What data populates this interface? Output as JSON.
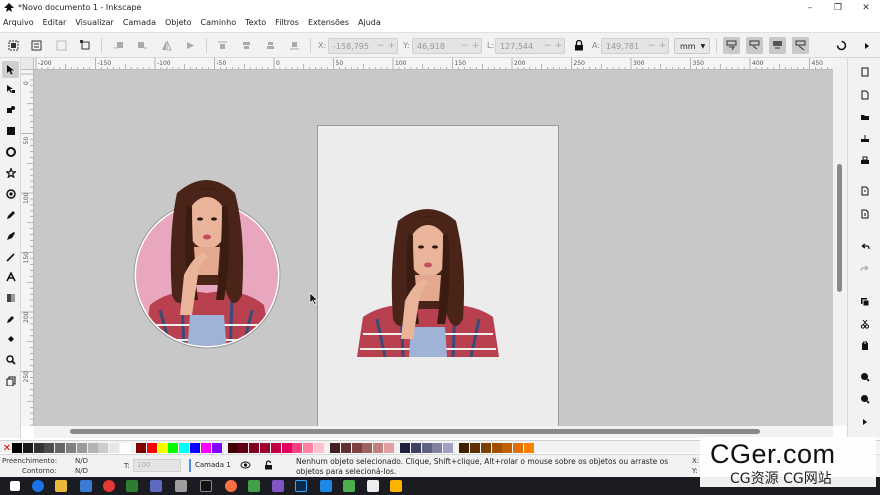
{
  "window": {
    "title": "*Novo documento 1 - Inkscape",
    "controls": [
      "minimize",
      "maximize",
      "close"
    ],
    "minimize_glyph": "–",
    "maximize_glyph": "❐",
    "close_glyph": "✕"
  },
  "menubar": {
    "items": [
      "Arquivo",
      "Editar",
      "Visualizar",
      "Camada",
      "Objeto",
      "Caminho",
      "Texto",
      "Filtros",
      "Extensões",
      "Ajuda"
    ]
  },
  "controls": {
    "x": {
      "label": "X:",
      "value": "-158,795"
    },
    "y": {
      "label": "Y:",
      "value": "46,918"
    },
    "w": {
      "label": "L:",
      "value": "127,544"
    },
    "h": {
      "label": "A:",
      "value": "149,781"
    },
    "unit": "mm",
    "spin_minus": "−",
    "spin_plus": "+"
  },
  "rulers": {
    "top_labels": [
      "-200",
      "-150",
      "-100",
      "-50",
      "0",
      "50",
      "100",
      "150",
      "200",
      "250",
      "300",
      "350",
      "400",
      "450"
    ],
    "left_labels": [
      "0",
      "50",
      "100",
      "150",
      "200",
      "250"
    ]
  },
  "toolbox": {
    "icons": [
      "selector-icon",
      "node-tool-icon",
      "tweak-tool-icon",
      "rectangle-tool-icon",
      "ellipse-tool-icon",
      "star-tool-icon",
      "spiral-tool-icon",
      "pencil-tool-icon",
      "pen-tool-icon",
      "calligraphy-tool-icon",
      "text-tool-icon",
      "gradient-tool-icon",
      "dropper-tool-icon",
      "paint-bucket-tool-icon",
      "zoom-tool-icon",
      "pages-tool-icon"
    ]
  },
  "palette": {
    "none_glyph": "✕",
    "colors": [
      "#000000",
      "#1a1a1a",
      "#333333",
      "#4d4d4d",
      "#666666",
      "#808080",
      "#999999",
      "#b3b3b3",
      "#cccccc",
      "#e6e6e6",
      "#ffffff",
      "#800000",
      "#ff0000",
      "#ffff00",
      "#00ff00",
      "#00ffff",
      "#0000ff",
      "#ff00ff",
      "#8000ff",
      "#400000",
      "#600010",
      "#800020",
      "#a00030",
      "#c00040",
      "#e00060",
      "#ff4080",
      "#ff80a0",
      "#ffc0d0",
      "#402020",
      "#603030",
      "#804040",
      "#a06060",
      "#c08080",
      "#e0a0a0",
      "#202040",
      "#404060",
      "#606080",
      "#8080a0",
      "#a0a0c0",
      "#402000",
      "#603000",
      "#804000",
      "#a05000",
      "#c06000",
      "#e07000",
      "#ff8000"
    ]
  },
  "status": {
    "fill_label": "Preenchimento:",
    "fill_value": "N/D",
    "stroke_label": "Contorno:",
    "stroke_value": "N/D",
    "opacity_label": "T:",
    "opacity_value": "100",
    "layer": "Camada 1",
    "message": "Nenhum objeto selecionado. Clique, Shift+clique, Alt+rolar o mouse sobre os objetos ou arraste os objetos para selecioná-los.",
    "coord_x_label": "X:",
    "coord_y_label": "Y:"
  },
  "watermark": {
    "big": "CGer.com",
    "small": "CG资源 CG网站"
  },
  "accent": "#4a90e2"
}
